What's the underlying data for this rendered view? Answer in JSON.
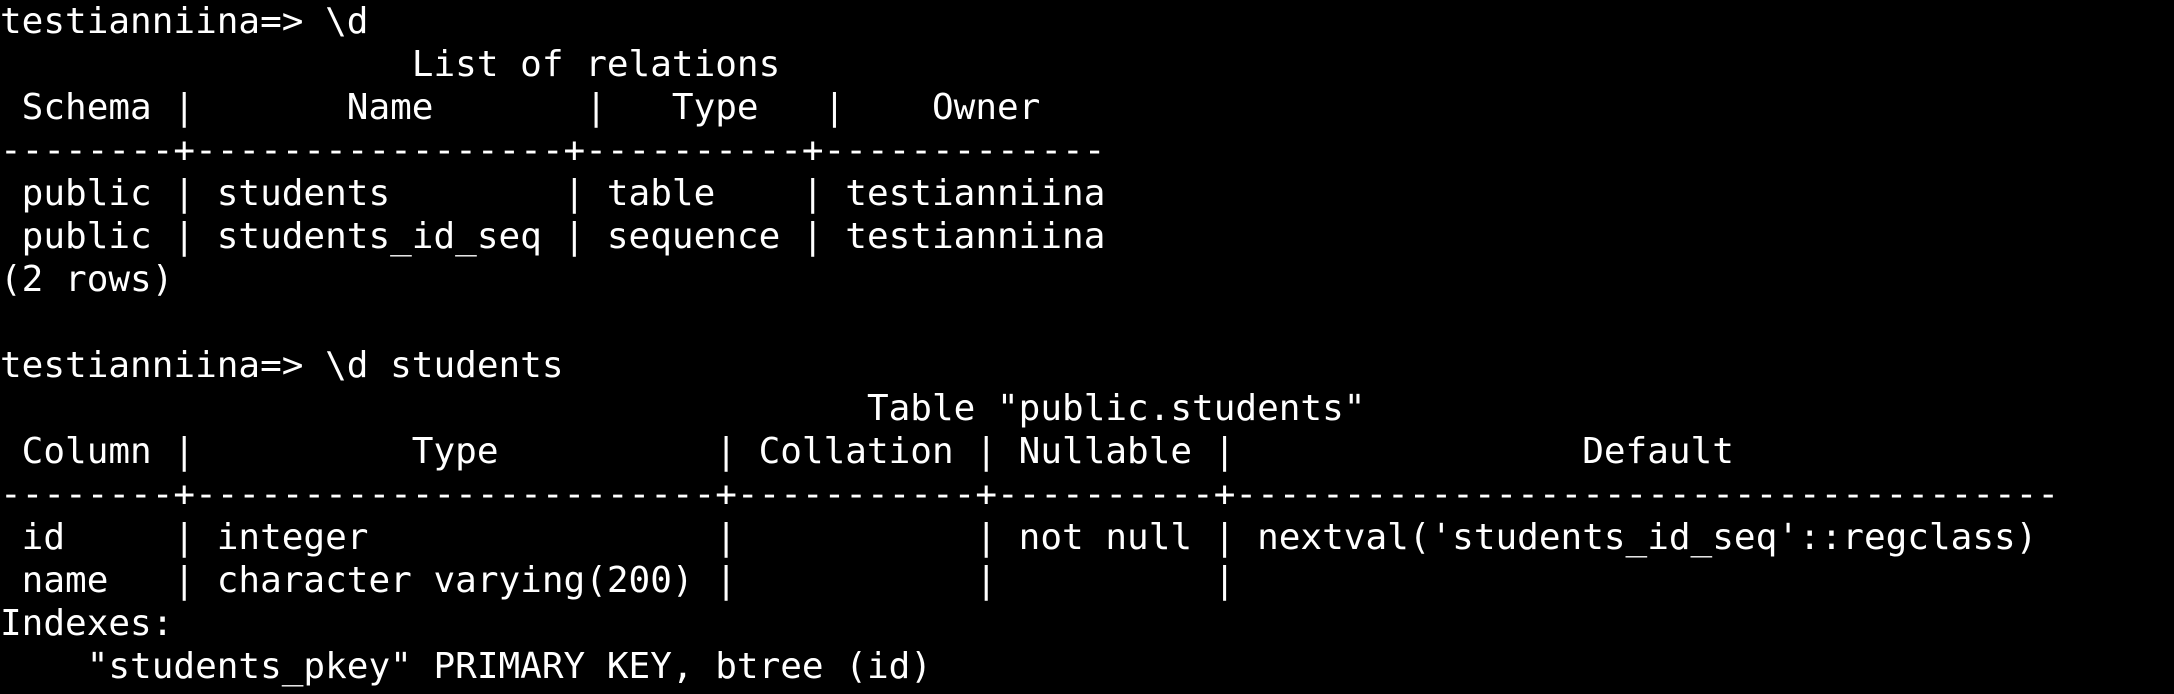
{
  "colors": {
    "background": "#000000",
    "foreground": "#ffffff"
  },
  "terminal": {
    "lines": [
      "testianniina=> \\d",
      "                   List of relations",
      " Schema |       Name       |   Type   |    Owner",
      "--------+-----------------+----------+-------------",
      " public | students        | table    | testianniina",
      " public | students_id_seq | sequence | testianniina",
      "(2 rows)",
      "",
      "testianniina=> \\d students",
      "                                        Table \"public.students\"",
      " Column |          Type          | Collation | Nullable |                Default",
      "--------+------------------------+-----------+----------+--------------------------------------",
      " id     | integer                |           | not null | nextval('students_id_seq'::regclass)",
      " name   | character varying(200) |           |          |",
      "Indexes:",
      "    \"students_pkey\" PRIMARY KEY, btree (id)"
    ]
  }
}
